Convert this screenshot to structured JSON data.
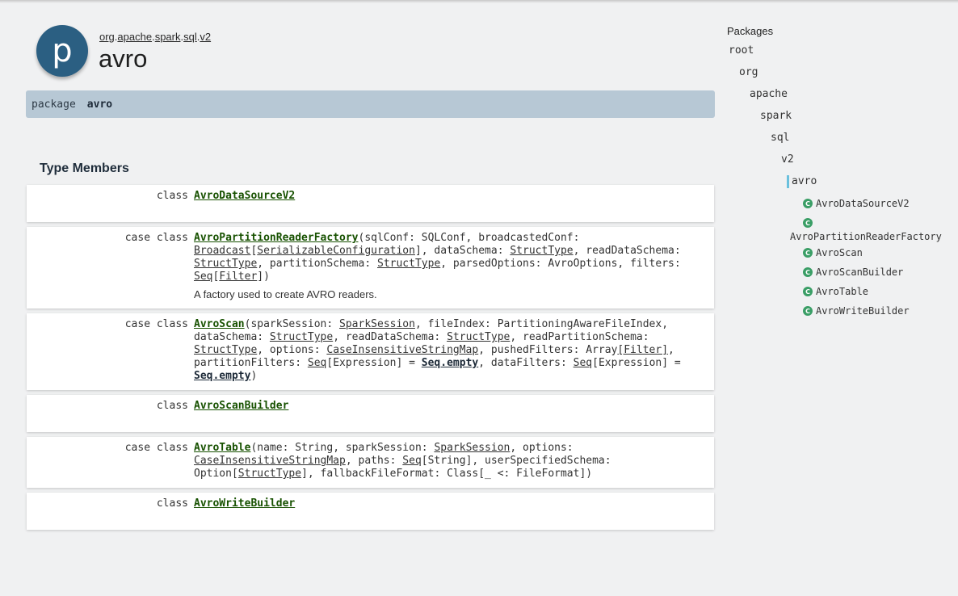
{
  "header": {
    "icon_letter": "p",
    "breadcrumb": [
      "org",
      "apache",
      "spark",
      "sql",
      "v2"
    ],
    "title": "avro"
  },
  "signature": {
    "keyword": "package",
    "name": "avro"
  },
  "section_title": "Type Members",
  "members": [
    {
      "mods": "class",
      "name": "AvroDataSourceV2"
    },
    {
      "mods": "case class",
      "name": "AvroPartitionReaderFactory",
      "sig": [
        {
          "t": "(sqlConf: SQLConf, broadcastedConf: "
        },
        {
          "t": "Broadcast",
          "link": true
        },
        {
          "t": "["
        },
        {
          "t": "SerializableConfiguration",
          "link": true
        },
        {
          "t": "], dataSchema: "
        },
        {
          "t": "StructType",
          "link": true
        },
        {
          "t": ", readDataSchema: "
        },
        {
          "t": "StructType",
          "link": true
        },
        {
          "t": ", partitionSchema: "
        },
        {
          "t": "StructType",
          "link": true
        },
        {
          "t": ", parsedOptions: AvroOptions, filters: "
        },
        {
          "t": "Seq",
          "link": true
        },
        {
          "t": "["
        },
        {
          "t": "Filter",
          "link": true
        },
        {
          "t": "])"
        }
      ],
      "comment": "A factory used to create AVRO readers."
    },
    {
      "mods": "case class",
      "name": "AvroScan",
      "sig": [
        {
          "t": "(sparkSession: "
        },
        {
          "t": "SparkSession",
          "link": true
        },
        {
          "t": ", fileIndex: PartitioningAwareFileIndex, dataSchema: "
        },
        {
          "t": "StructType",
          "link": true
        },
        {
          "t": ", readDataSchema: "
        },
        {
          "t": "StructType",
          "link": true
        },
        {
          "t": ", readPartitionSchema: "
        },
        {
          "t": "StructType",
          "link": true
        },
        {
          "t": ", options: "
        },
        {
          "t": "CaseInsensitiveStringMap",
          "link": true
        },
        {
          "t": ", pushedFilters: Array"
        },
        {
          "t": "[Filter]",
          "link": true
        },
        {
          "t": ", partitionFilters: "
        },
        {
          "t": "Seq",
          "link": true
        },
        {
          "t": "[Expression] = "
        },
        {
          "t": "Seq.empty",
          "link": true,
          "strong": true
        },
        {
          "t": ", dataFilters: "
        },
        {
          "t": "Seq",
          "link": true
        },
        {
          "t": "[Expression] = "
        },
        {
          "t": "Seq.empty",
          "link": true,
          "strong": true
        },
        {
          "t": ")"
        }
      ]
    },
    {
      "mods": "class",
      "name": "AvroScanBuilder"
    },
    {
      "mods": "case class",
      "name": "AvroTable",
      "sig": [
        {
          "t": "(name: String, sparkSession: "
        },
        {
          "t": "SparkSession",
          "link": true
        },
        {
          "t": ", options: "
        },
        {
          "t": "CaseInsensitiveStringMap",
          "link": true
        },
        {
          "t": ", paths: "
        },
        {
          "t": "Seq",
          "link": true
        },
        {
          "t": "[String], userSpecifiedSchema: Option["
        },
        {
          "t": "StructType",
          "link": true
        },
        {
          "t": "], fallbackFileFormat: Class[_ <: FileFormat])"
        }
      ]
    },
    {
      "mods": "class",
      "name": "AvroWriteBuilder"
    }
  ],
  "sidebar": {
    "heading": "Packages",
    "tree": [
      "root",
      "org",
      "apache",
      "spark",
      "sql",
      "v2",
      "avro"
    ],
    "classes": [
      "AvroDataSourceV2",
      "AvroPartitionReaderFactory",
      "AvroScan",
      "AvroScanBuilder",
      "AvroTable",
      "AvroWriteBuilder"
    ],
    "class_icon_letter": "C"
  }
}
